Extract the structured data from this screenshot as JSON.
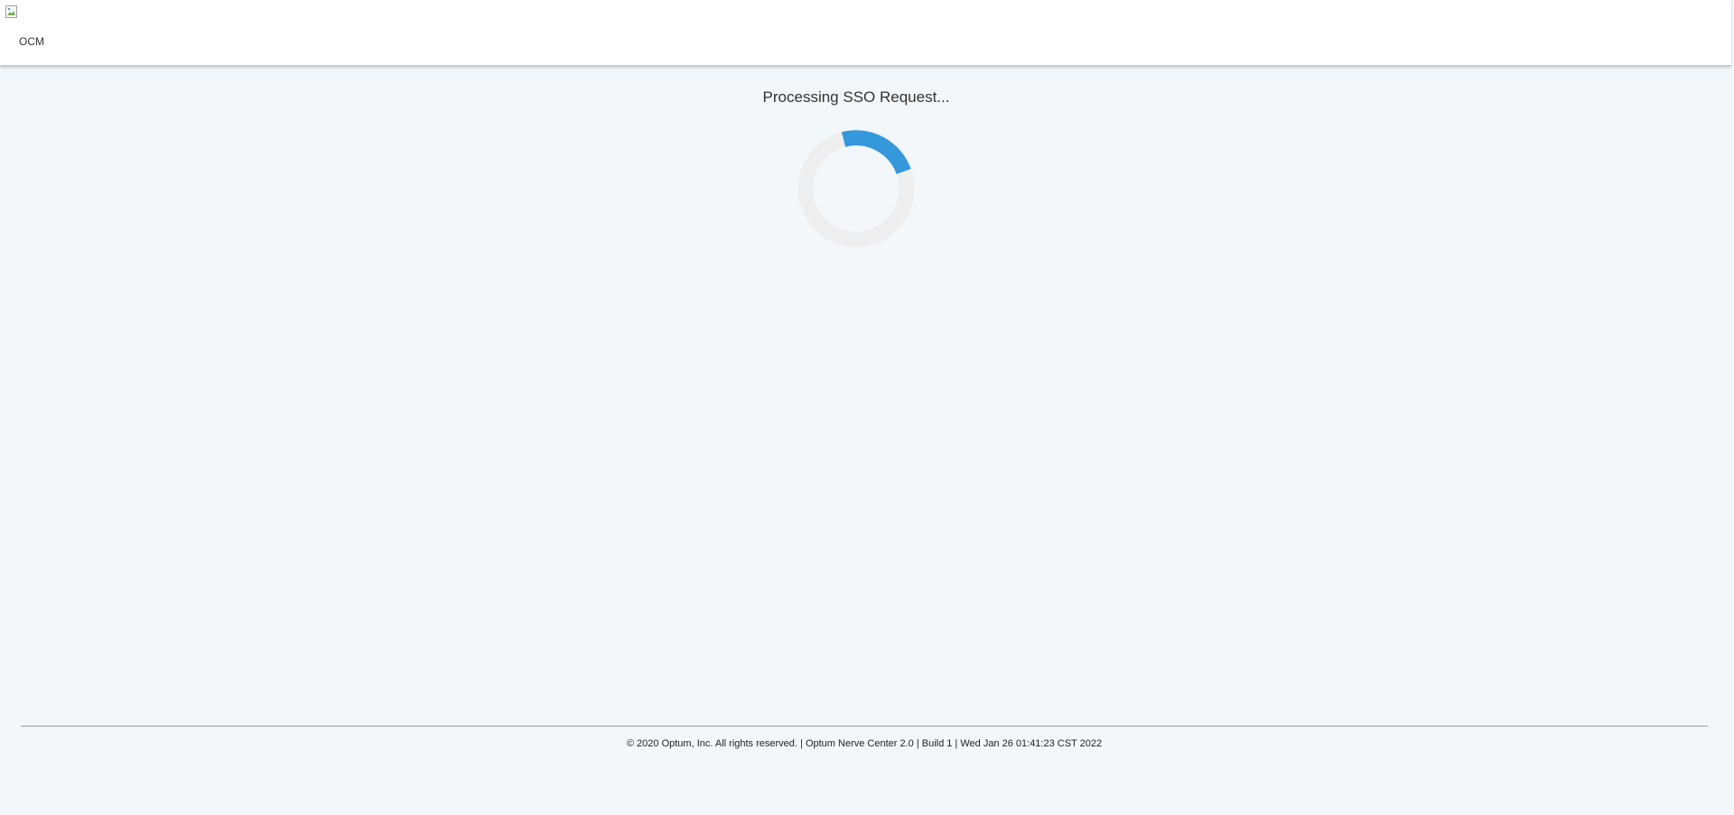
{
  "header": {
    "logo_icon": "broken-image-icon",
    "app_name": "OCM"
  },
  "main": {
    "status_text": "Processing SSO Request...",
    "spinner": {
      "icon": "loading-spinner-icon",
      "track_color": "#eeeeee",
      "accent_color": "#3498db"
    }
  },
  "footer": {
    "text": "© 2020 Optum, Inc. All rights reserved. | Optum Nerve Center 2.0 | Build 1 | Wed Jan 26 01:41:23 CST 2022"
  },
  "colors": {
    "page_background": "#f3f7fa",
    "header_background": "#ffffff"
  }
}
